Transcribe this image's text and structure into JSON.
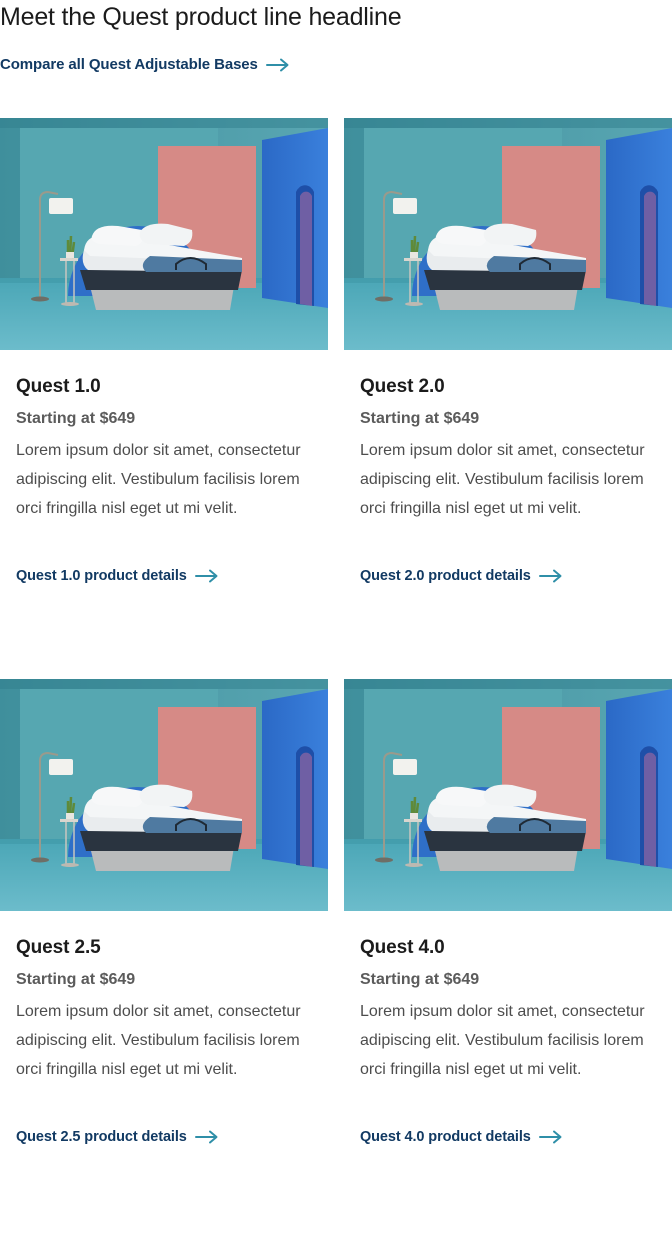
{
  "header": {
    "headline": "Meet the Quest product line headline",
    "compare_link": "Compare all Quest Adjustable Bases"
  },
  "colors": {
    "link": "#123a63",
    "arrow": "#2f8fa8",
    "scene_teal": "#4fa3ad",
    "scene_pink": "#d98a85",
    "scene_blue": "#2f74d0"
  },
  "products": [
    {
      "title": "Quest 1.0",
      "price": "Starting at $649",
      "description": "Lorem ipsum dolor sit amet, consectetur adipiscing elit. Vestibulum facilisis lorem orci fringilla nisl eget ut mi velit.",
      "link": "Quest 1.0 product details",
      "image_icon": "adjustable-bed-scene-image"
    },
    {
      "title": "Quest 2.0",
      "price": "Starting at $649",
      "description": "Lorem ipsum dolor sit amet, consectetur adipiscing elit. Vestibulum facilisis lorem orci fringilla nisl eget ut mi velit.",
      "link": "Quest 2.0 product details",
      "image_icon": "adjustable-bed-scene-image"
    },
    {
      "title": "Quest 2.5",
      "price": "Starting at $649",
      "description": "Lorem ipsum dolor sit amet, consectetur adipiscing elit. Vestibulum facilisis lorem orci fringilla nisl eget ut mi velit.",
      "link": "Quest 2.5 product details",
      "image_icon": "adjustable-bed-scene-image"
    },
    {
      "title": "Quest 4.0",
      "price": "Starting at $649",
      "description": "Lorem ipsum dolor sit amet, consectetur adipiscing elit. Vestibulum facilisis lorem orci fringilla nisl eget ut mi velit.",
      "link": "Quest 4.0 product details",
      "image_icon": "adjustable-bed-scene-image"
    }
  ]
}
